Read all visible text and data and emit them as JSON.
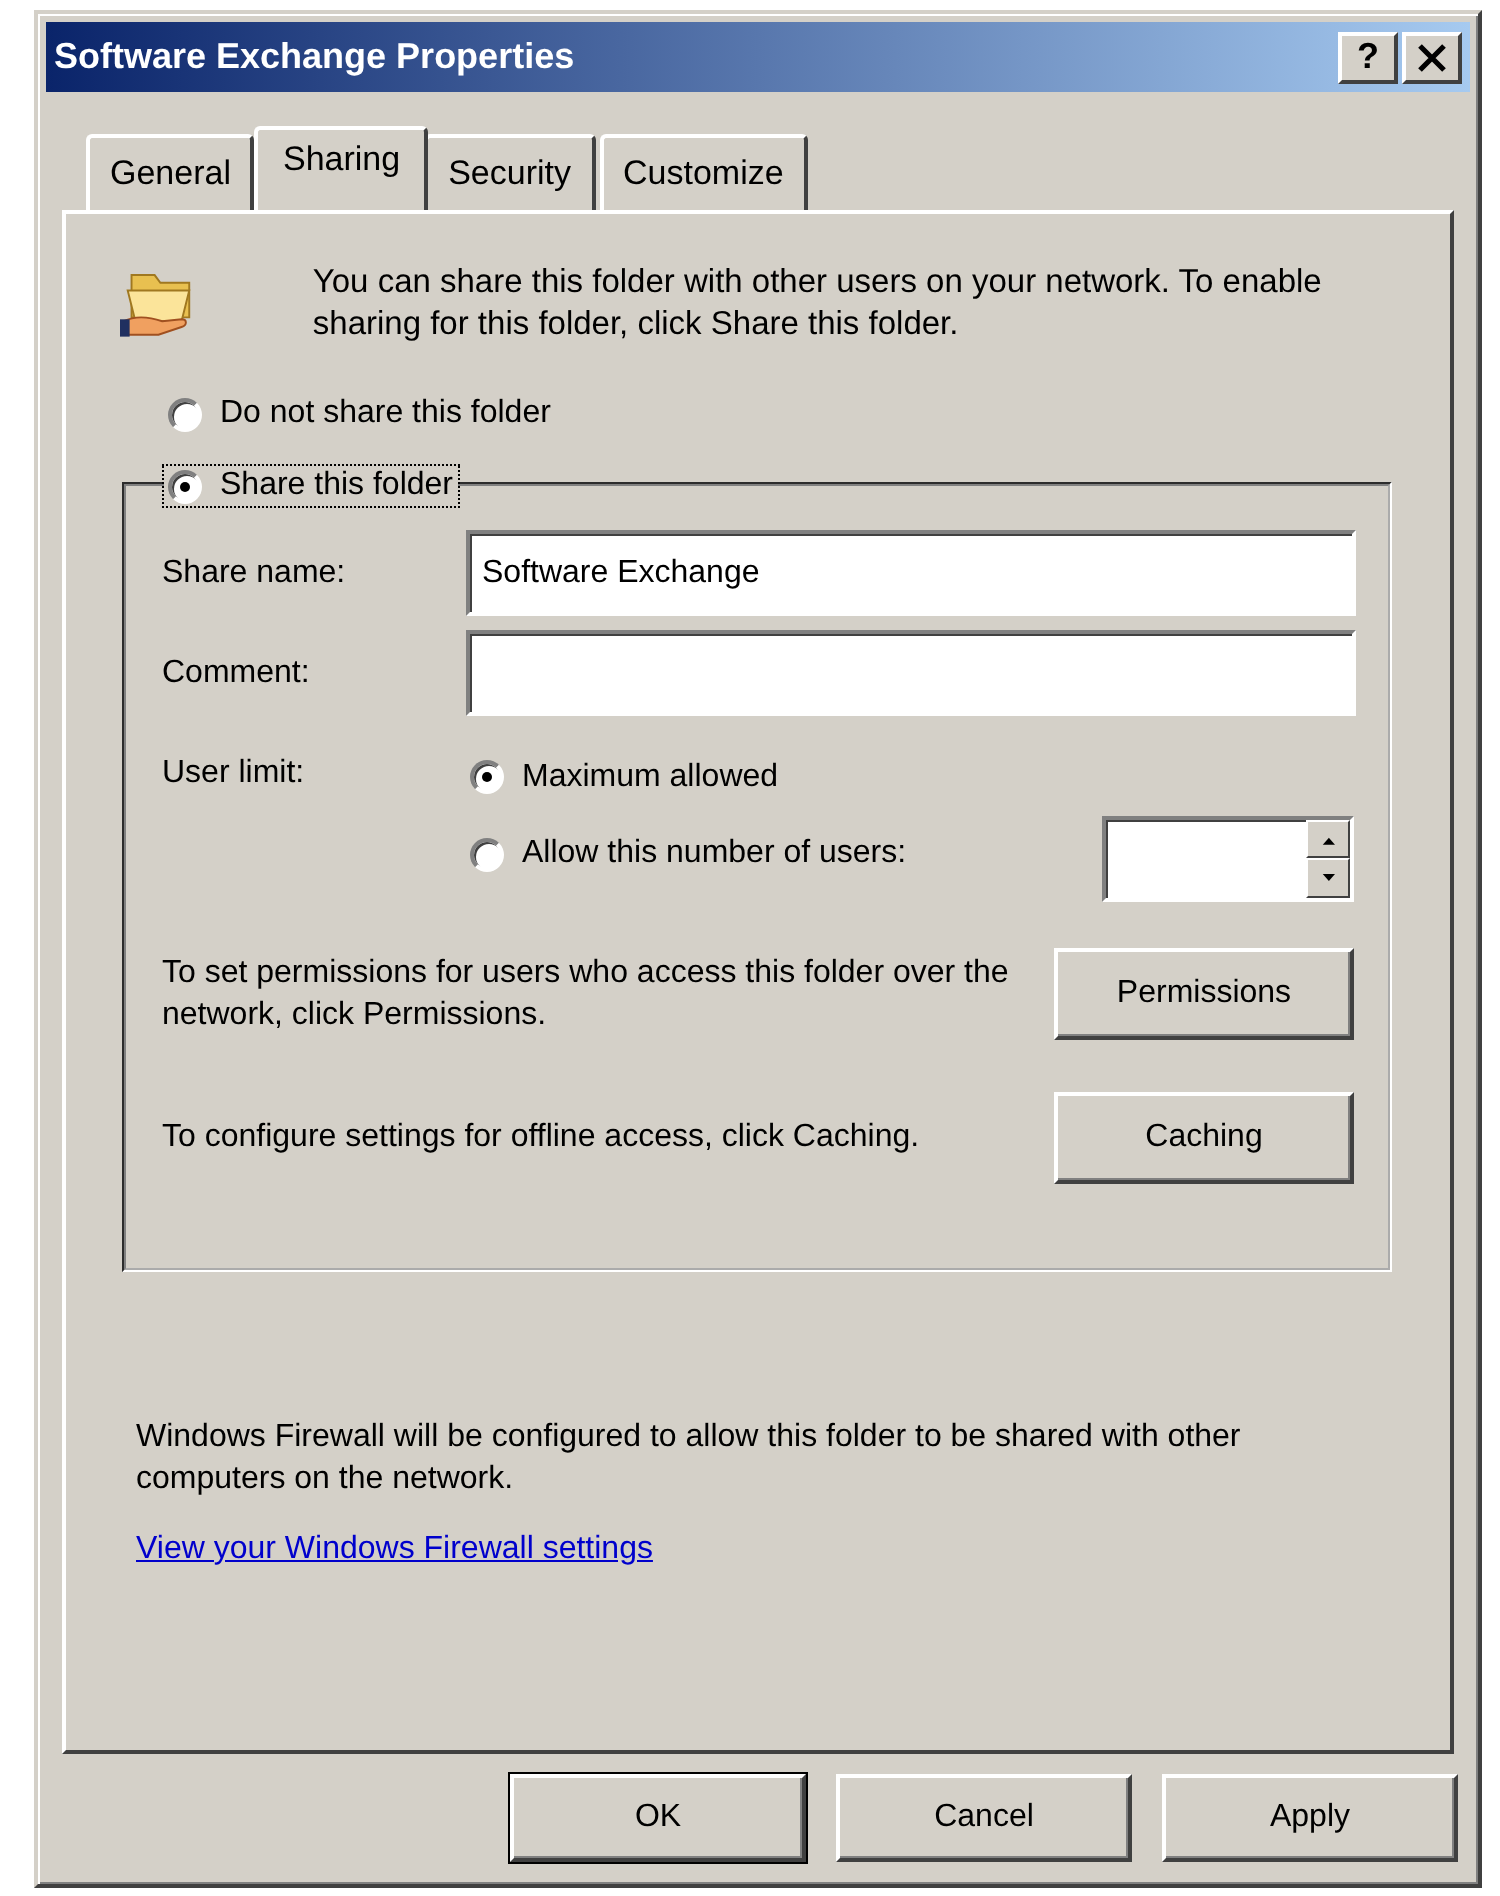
{
  "window": {
    "title": "Software Exchange Properties",
    "help_button": "?"
  },
  "tabs": [
    {
      "label": "General",
      "selected": false
    },
    {
      "label": "Sharing",
      "selected": true
    },
    {
      "label": "Security",
      "selected": false
    },
    {
      "label": "Customize",
      "selected": false
    }
  ],
  "intro": "You can share this folder with other users on your network.  To enable sharing for this folder, click Share this folder.",
  "sharing_options": [
    {
      "label": "Do not share this folder",
      "selected": false,
      "focused": false
    },
    {
      "label": "Share this folder",
      "selected": true,
      "focused": true
    }
  ],
  "share_name": {
    "label": "Share name:",
    "value": "Software Exchange"
  },
  "comment": {
    "label": "Comment:"
  },
  "user_limit": {
    "label": "User limit:",
    "options": [
      {
        "label": "Maximum allowed",
        "selected": true
      },
      {
        "label": "Allow this number of users:",
        "selected": false
      }
    ]
  },
  "permissions": {
    "text": "To set permissions for users who access this folder over the network, click Permissions.",
    "button": "Permissions"
  },
  "caching": {
    "text": "To configure settings for offline access, click Caching.",
    "button": "Caching"
  },
  "firewall_note": "Windows Firewall will be configured to allow this folder to be shared with other computers on the network.",
  "firewall_link": "View your Windows Firewall settings",
  "buttons": [
    {
      "label": "OK",
      "default": true
    },
    {
      "label": "Cancel",
      "default": false
    },
    {
      "label": "Apply",
      "default": false
    }
  ]
}
